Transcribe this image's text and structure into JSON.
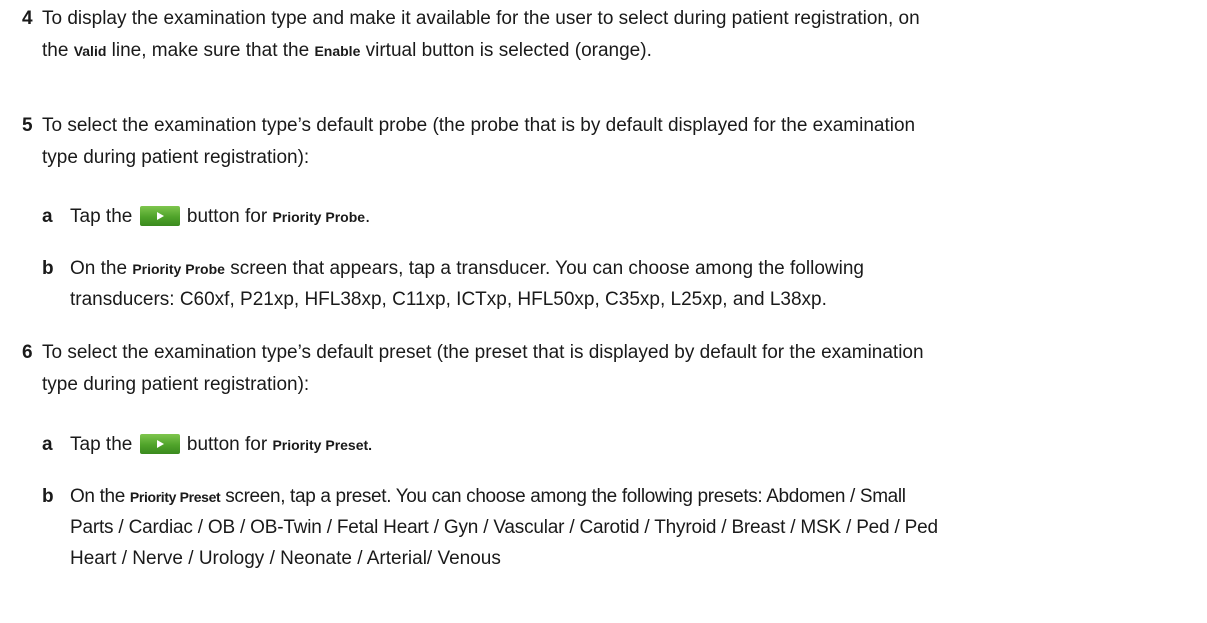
{
  "steps": {
    "s4": {
      "num": "4",
      "l1_a": "To display the examination type and make it available for the user to select during patient registration, on",
      "l2_a": "the ",
      "l2_ui1": "Valid",
      "l2_b": " line, make sure that the ",
      "l2_ui2": "Enable",
      "l2_c": " virtual button is selected (orange)."
    },
    "s5": {
      "num": "5",
      "l1": "To select the examination type’s default probe (the probe that is by default displayed for the examination",
      "l2": "type during patient registration):",
      "a": {
        "letter": "a",
        "t1": "Tap the ",
        "t2": " button for ",
        "ui": "Priority Probe",
        "t3": "."
      },
      "b": {
        "letter": "b",
        "t1": "On the ",
        "ui": "Priority Probe",
        "t2": " screen that appears, tap a transducer. You can choose among the following",
        "l2": "transducers: C60xf, P21xp, HFL38xp,  C11xp, ICTxp, HFL50xp, C35xp, L25xp, and L38xp."
      }
    },
    "s6": {
      "num": "6",
      "l1": "To select the examination type’s default preset (the preset that is displayed by default for the examination",
      "l2": "type during patient registration):",
      "a": {
        "letter": "a",
        "t1": "Tap the ",
        "t2": " button for ",
        "ui": "Priority Preset.",
        "t3": ""
      },
      "b": {
        "letter": "b",
        "t1": "On the ",
        "ui": "Priority Preset",
        "t2": " screen, tap a preset. You can choose among the following presets: Abdomen / Small",
        "l2": "Parts / Cardiac / OB / OB-Twin / Fetal Heart / Gyn / Vascular / Carotid / Thyroid / Breast / MSK / Ped / Ped",
        "l3": "Heart / Nerve / Urology / Neonate / Arterial/ Venous"
      }
    }
  }
}
